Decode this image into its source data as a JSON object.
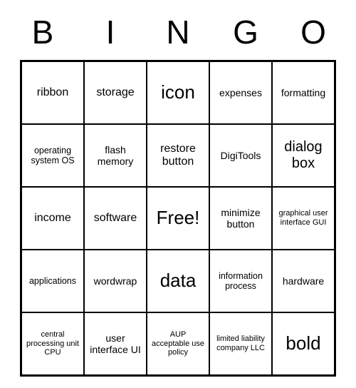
{
  "header_letters": [
    "B",
    "I",
    "N",
    "G",
    "O"
  ],
  "cells": [
    [
      {
        "text": "ribbon",
        "size": "sm"
      },
      {
        "text": "storage",
        "size": "sm"
      },
      {
        "text": "icon",
        "size": "lg"
      },
      {
        "text": "expenses",
        "size": "xs"
      },
      {
        "text": "formatting",
        "size": "xs"
      }
    ],
    [
      {
        "text": "operating system OS",
        "size": "xxs"
      },
      {
        "text": "flash memory",
        "size": "xs"
      },
      {
        "text": "restore button",
        "size": "sm"
      },
      {
        "text": "DigiTools",
        "size": "xs"
      },
      {
        "text": "dialog box",
        "size": "md"
      }
    ],
    [
      {
        "text": "income",
        "size": "sm"
      },
      {
        "text": "software",
        "size": "sm"
      },
      {
        "text": "Free!",
        "size": "lg"
      },
      {
        "text": "minimize button",
        "size": "xs"
      },
      {
        "text": "graphical user interface GUI",
        "size": "xxxs"
      }
    ],
    [
      {
        "text": "applications",
        "size": "xxs"
      },
      {
        "text": "wordwrap",
        "size": "xs"
      },
      {
        "text": "data",
        "size": "lg"
      },
      {
        "text": "information process",
        "size": "xxs"
      },
      {
        "text": "hardware",
        "size": "xs"
      }
    ],
    [
      {
        "text": "central processing unit CPU",
        "size": "xxxs"
      },
      {
        "text": "user interface UI",
        "size": "xs"
      },
      {
        "text": "AUP acceptable use policy",
        "size": "xxxs"
      },
      {
        "text": "limited liability company LLC",
        "size": "xxxs"
      },
      {
        "text": "bold",
        "size": "lg"
      }
    ]
  ]
}
